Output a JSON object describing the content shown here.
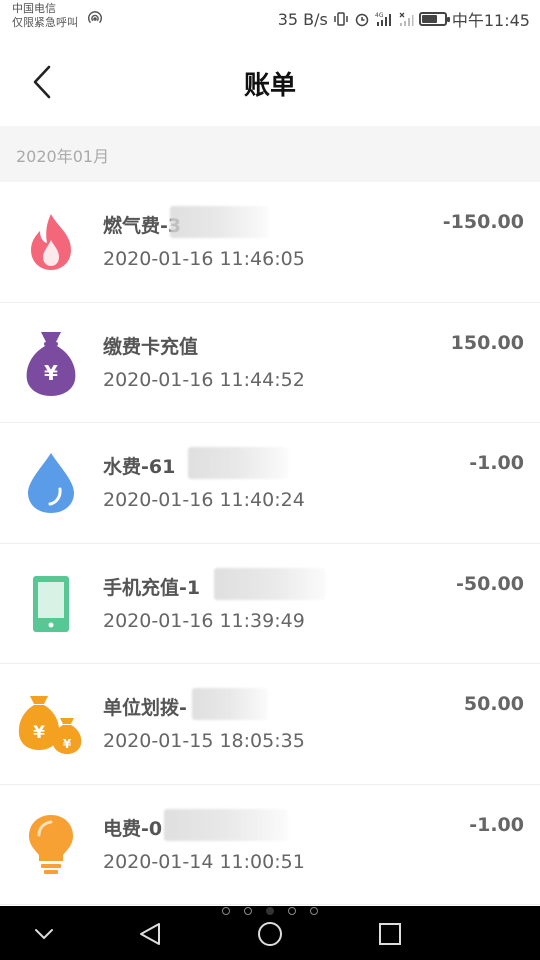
{
  "status_bar": {
    "carrier_line1": "中国电信",
    "carrier_line2": "仅限紧急呼叫",
    "net_speed": "35 B/s",
    "network": "4G",
    "time": "中午11:45",
    "battery_level": 0.7
  },
  "header": {
    "title": "账单"
  },
  "section": {
    "label": "2020年01月"
  },
  "bills": [
    {
      "name": "燃气费-3",
      "time": "2020-01-16 11:46:05",
      "amount": "-150.00",
      "icon": "fire-icon",
      "color": "#f4667a"
    },
    {
      "name": "缴费卡充值",
      "time": "2020-01-16 11:44:52",
      "amount": "150.00",
      "icon": "money-bag-icon",
      "color": "#7b4ba0"
    },
    {
      "name": "水费-61",
      "time": "2020-01-16 11:40:24",
      "amount": "-1.00",
      "icon": "water-drop-icon",
      "color": "#5b9ce8"
    },
    {
      "name": "手机充值-1",
      "time": "2020-01-16 11:39:49",
      "amount": "-50.00",
      "icon": "phone-icon",
      "color": "#57c894"
    },
    {
      "name": "单位划拨-",
      "time": "2020-01-15 18:05:35",
      "amount": "50.00",
      "icon": "coin-bags-icon",
      "color": "#f4a020"
    },
    {
      "name": "电费-0",
      "time": "2020-01-14 11:00:51",
      "amount": "-1.00",
      "icon": "lightbulb-icon",
      "color": "#f7a033"
    }
  ],
  "page_indicator": {
    "count": 5,
    "active": 2
  }
}
